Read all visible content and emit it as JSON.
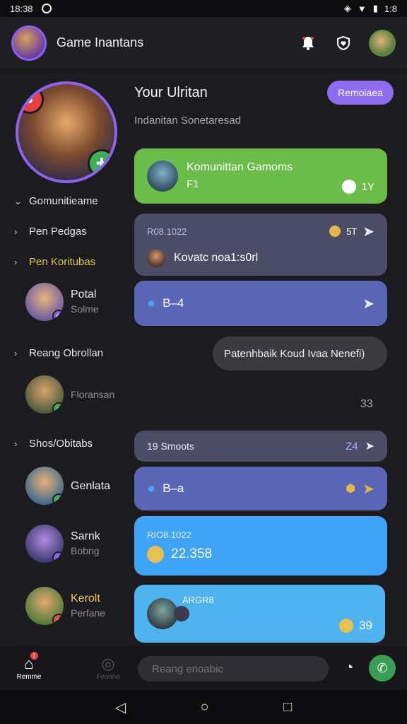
{
  "status": {
    "time": "18:38",
    "battery": "1:8"
  },
  "appbar": {
    "title": "Game Inantans",
    "icons": [
      "bell-icon",
      "shield-heart-icon"
    ]
  },
  "profile": {
    "notif_icon": "chat-icon",
    "badge_icon": "gamepad-icon"
  },
  "sidebar": {
    "sections": [
      {
        "label": "Gomunitieame",
        "expanded": true
      },
      {
        "label": "Pen Pedgas",
        "expanded": false
      },
      {
        "label": "Pen Koritubas",
        "expanded": false
      },
      {
        "label": "Reang Obrollan",
        "expanded": false
      },
      {
        "label": "Shos/Obitabs",
        "expanded": false
      }
    ],
    "members": [
      {
        "name": "Potal",
        "sub": "Solme",
        "status_color": "#8a5cf0",
        "status_icon": "◆"
      },
      {
        "name": "",
        "sub": "Floransan",
        "status_color": "#3fae5b",
        "status_icon": "●"
      },
      {
        "name": "Genlata",
        "sub": "",
        "status_color": "#3fae5b",
        "status_icon": "●"
      },
      {
        "name": "Sarnk",
        "sub": "Bobng",
        "status_color": "#8a5cf0",
        "status_icon": "●"
      },
      {
        "name": "Kerolt",
        "sub": "Perfane",
        "status_color": "#e0553b",
        "status_icon": "●",
        "name_color": "#e6c84a"
      }
    ]
  },
  "main": {
    "title": "Your Ulritan",
    "subtitle": "Indanitan Sonetaresad",
    "button": "Remoiaea"
  },
  "cards": {
    "green": {
      "title": "Komunittan Gamoms",
      "sub": "F1",
      "meta": "1Y"
    },
    "dark": {
      "small": "R08.1022",
      "meta": "5T",
      "text": "Kovatc noa1:s0rl"
    },
    "blue1": {
      "text": "B–4"
    },
    "bubble": "Patenhbaik Koud Ivaa Nenefi)",
    "count": "33",
    "row_dark": {
      "text": "19 Smoots",
      "count": "Z4"
    },
    "blue2": {
      "text": "B–a"
    },
    "sky1": {
      "small": "RIO8.1022",
      "text": "22.358"
    },
    "sky2": {
      "small": "ARGR8",
      "count": "39"
    }
  },
  "bottom": {
    "tabs": [
      {
        "label": "Remme",
        "icon": "home-icon",
        "active": true,
        "dot": "1"
      },
      {
        "label": "Fvonne",
        "icon": "search-icon",
        "active": false
      }
    ],
    "input_placeholder": "Reang enoabic"
  },
  "colors": {
    "accent": "#8d6cf0",
    "green_card": "#6bbd4a",
    "dark_card": "#4b4c66",
    "blue_card": "#5b65b5",
    "sky_card": "#3fa4f5",
    "sky_card2": "#4fb3ef"
  }
}
